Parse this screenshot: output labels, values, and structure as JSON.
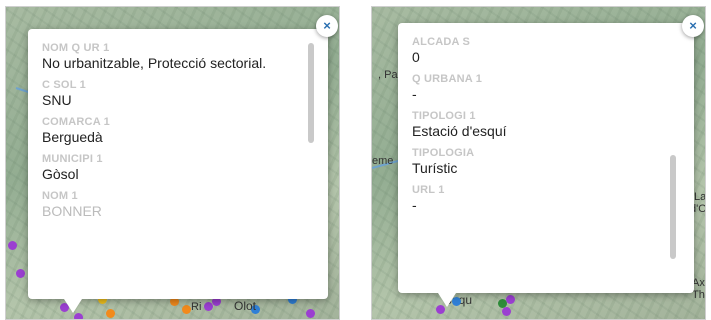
{
  "left_panel": {
    "close_symbol": "×",
    "fields": [
      {
        "label": "NOM Q UR 1",
        "value": "No urbanitzable, Protecció sectorial."
      },
      {
        "label": "C SOL 1",
        "value": "SNU"
      },
      {
        "label": "COMARCA 1",
        "value": "Berguedà"
      },
      {
        "label": "MUNICIPI 1",
        "value": "Gòsol"
      },
      {
        "label": "NOM 1",
        "value": "BONNER"
      }
    ],
    "map_labels": {
      "ripoll": "Ri",
      "olot": "Olot"
    }
  },
  "right_panel": {
    "close_symbol": "×",
    "fields": [
      {
        "label": "ALCADA S",
        "value": "0"
      },
      {
        "label": "Q URBANA 1",
        "value": "-"
      },
      {
        "label": "TIPOLOGI 1",
        "value": "Estació d'esquí"
      },
      {
        "label": "TIPOLOGIA",
        "value": "Turístic"
      },
      {
        "label": "URL 1",
        "value": "-"
      }
    ],
    "map_labels": {
      "pa": ", Pa",
      "eme": "eme",
      "baqu": "Baqu",
      "la": "La",
      "do": "d'O",
      "ax": "Ax-",
      "the": "Thè"
    }
  },
  "colors": {
    "link_blue": "#2a6fb0",
    "label_gray": "#c6c6c6",
    "dot_purple": "#9b3fd1",
    "dot_orange": "#f28a1c",
    "dot_blue": "#2f7fd6",
    "dot_green": "#2e8b3a"
  }
}
